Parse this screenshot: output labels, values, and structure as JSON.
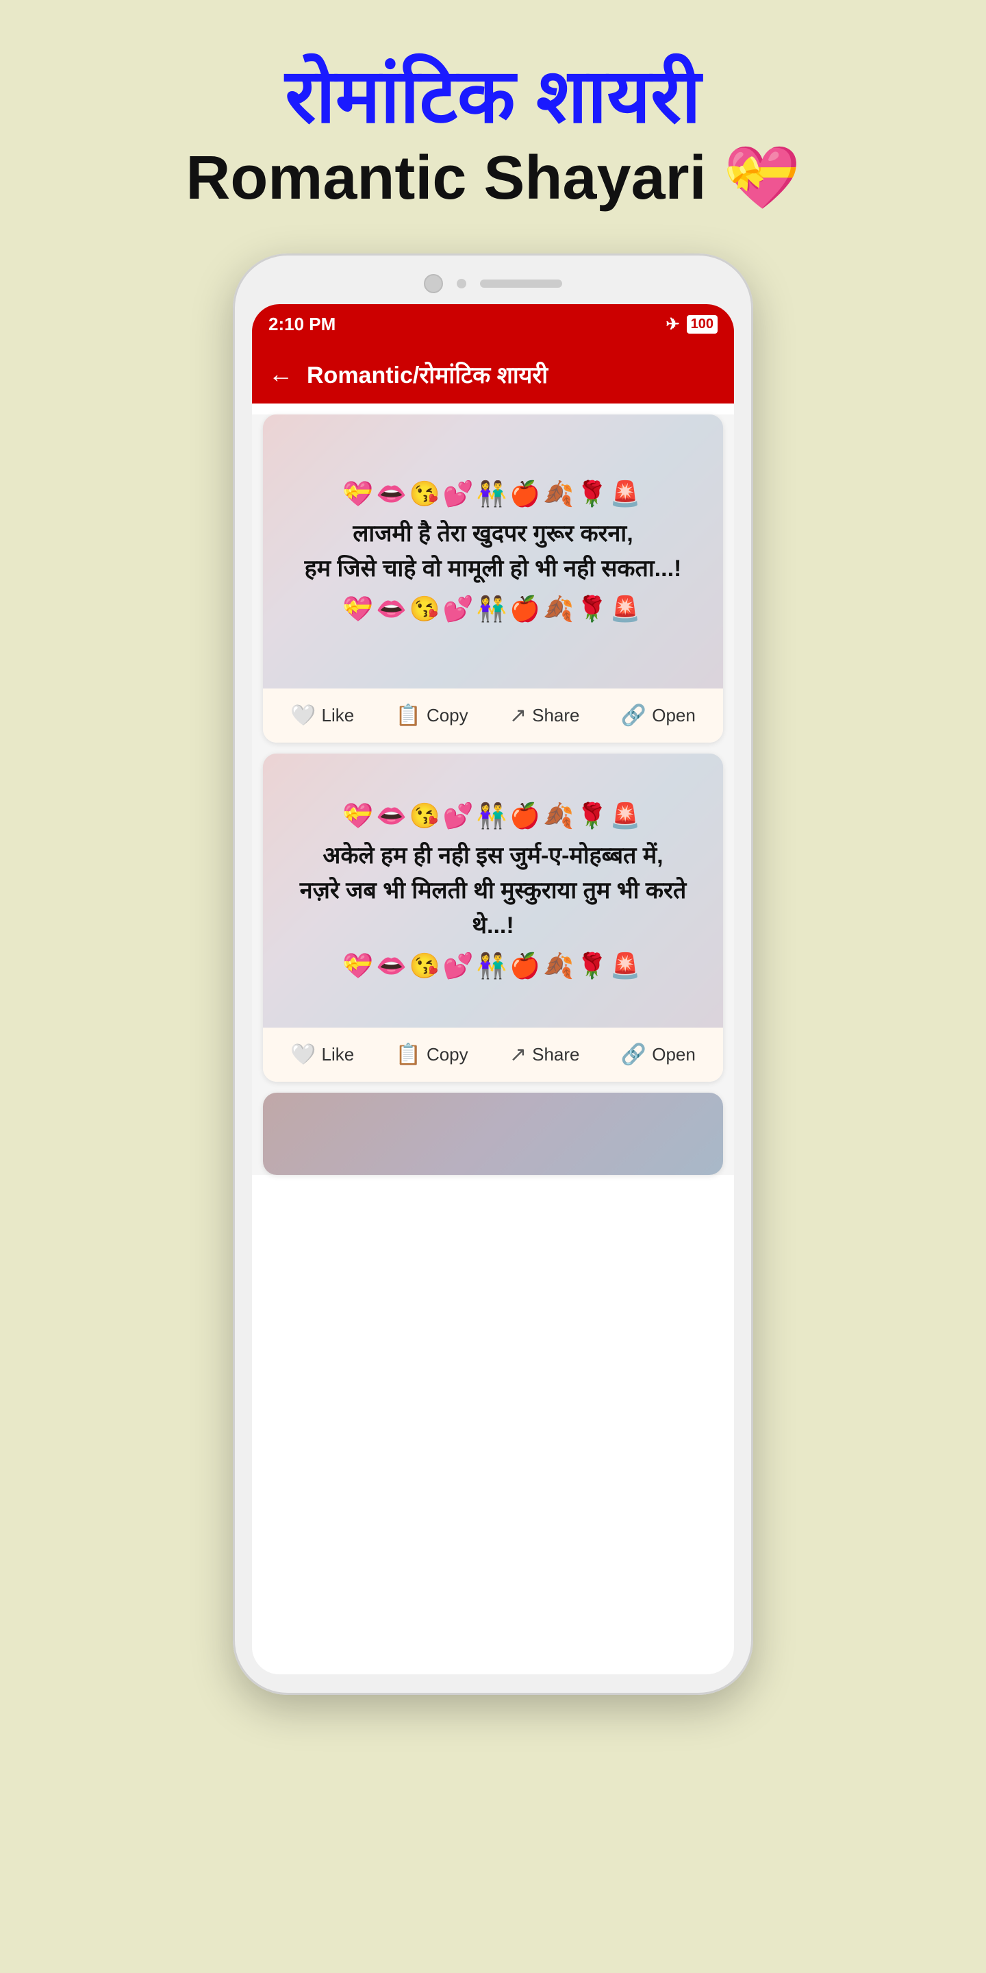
{
  "header": {
    "hindi_title": "रोमांटिक शायरी",
    "english_title": "Romantic Shayari 💝"
  },
  "status_bar": {
    "time": "2:10 PM",
    "battery": "100",
    "airplane": "✈"
  },
  "app_bar": {
    "back_label": "←",
    "title": "Romantic/रोमांटिक शायरी"
  },
  "cards": [
    {
      "id": "card1",
      "emoji_top": "💝👄😘💕👫🍎🍂🌹🚨",
      "text_line1": "लाजमी है तेरा खुदपर गुरूर करना,",
      "text_line2": "हम जिसे चाहे वो मामूली हो भी नही सकता...!",
      "emoji_bottom": "💝👄😘💕👫🍎🍂🌹🚨",
      "like_label": "Like",
      "copy_label": "Copy",
      "share_label": "Share",
      "open_label": "Open"
    },
    {
      "id": "card2",
      "emoji_top": "💝👄😘💕👫🍎🍂🌹🚨",
      "text_line1": "अकेले हम ही नही इस जुर्म-ए-मोहब्बत में,",
      "text_line2": "नज़रे जब भी मिलती थी मुस्कुराया तुम भी करते थे...!",
      "emoji_bottom": "💝👄😘💕👫🍎🍂🌹🚨",
      "like_label": "Like",
      "copy_label": "Copy",
      "share_label": "Share",
      "open_label": "Open"
    }
  ],
  "icons": {
    "like": "🤍",
    "copy": "📋",
    "share": "↗",
    "open": "↗"
  }
}
